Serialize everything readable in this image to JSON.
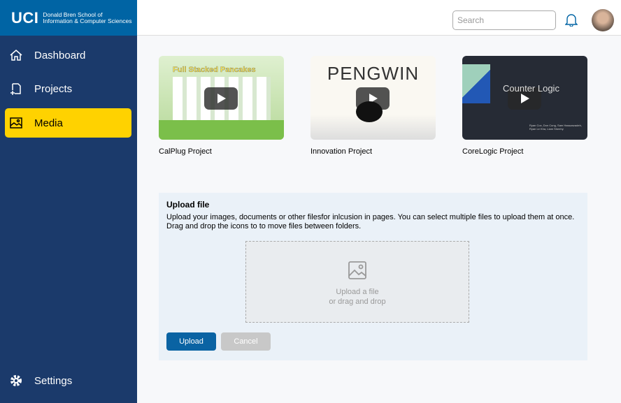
{
  "brand": {
    "logo": "UCI",
    "line1": "Donald Bren School of",
    "line2": "Information & Computer Sciences"
  },
  "sidebar": {
    "items": [
      {
        "label": "Dashboard",
        "icon": "home-icon"
      },
      {
        "label": "Projects",
        "icon": "projects-icon"
      },
      {
        "label": "Media",
        "icon": "image-icon",
        "active": true
      }
    ],
    "settings": "Settings"
  },
  "header": {
    "search_placeholder": "Search"
  },
  "media": [
    {
      "label": "CalPlug Project",
      "thumb_text": "Full Stacked Pancakes"
    },
    {
      "label": "Innovation Project",
      "thumb_text": "PENGWIN"
    },
    {
      "label": "CoreLogic Project",
      "thumb_text": "Counter Logic",
      "thumb_credits": "Ryan Cox, Don Cung, Sam Hassanzadeh, Ryan Le Kha, Liam Sheehy"
    }
  ],
  "upload": {
    "title": "Upload file",
    "description": "Upload your images, documents or other filesfor inlcusion in pages. You can select multiple files to upload them at once. Drag and drop the icons to to move files between folders.",
    "drop_line1": "Upload a file",
    "drop_line2": "or drag and drop",
    "upload_label": "Upload",
    "cancel_label": "Cancel"
  },
  "colors": {
    "sidebar": "#1b3a6b",
    "brand": "#0064a4",
    "active": "#ffd200"
  }
}
